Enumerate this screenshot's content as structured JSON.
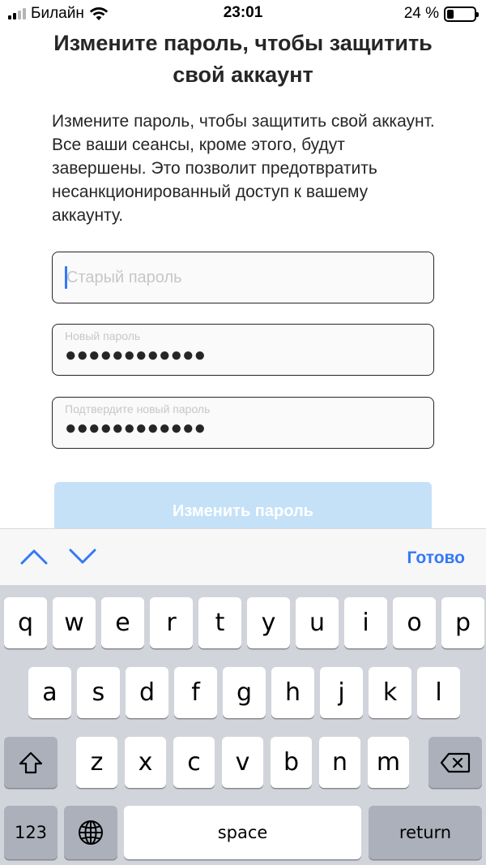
{
  "status_bar": {
    "carrier": "Билайн",
    "time": "23:01",
    "battery_percent": "24 %",
    "battery_level": 0.24
  },
  "title": "Измените пароль, чтобы защитить свой аккаунт",
  "description": "Измените пароль, чтобы защитить свой аккаунт. Все ваши сеансы, кроме этого, будут завершены. Это позволит предотвратить несанкционированный доступ к вашему аккаунту.",
  "fields": {
    "old_password": {
      "placeholder": "Старый пароль"
    },
    "new_password": {
      "label": "Новый пароль",
      "masked_value": "●●●●●●●●●●●●"
    },
    "confirm_password": {
      "label": "Подтвердите новый пароль",
      "masked_value": "●●●●●●●●●●●●"
    }
  },
  "submit_label": "Изменить пароль",
  "accessory": {
    "done_label": "Готово",
    "icons": [
      "chevron-up-icon",
      "chevron-down-icon"
    ]
  },
  "keyboard": {
    "row1": [
      "q",
      "w",
      "e",
      "r",
      "t",
      "y",
      "u",
      "i",
      "o",
      "p"
    ],
    "row2": [
      "a",
      "s",
      "d",
      "f",
      "g",
      "h",
      "j",
      "k",
      "l"
    ],
    "row3": [
      "z",
      "x",
      "c",
      "v",
      "b",
      "n",
      "m"
    ],
    "numbers_label": "123",
    "space_label": "space",
    "return_label": "return",
    "icons": [
      "shift-icon",
      "backspace-icon",
      "globe-icon"
    ]
  },
  "colors": {
    "accent": "#3478f6",
    "button_disabled": "#c4e1f8",
    "keyboard_bg": "#d1d4da",
    "key_dark": "#abb0bb"
  }
}
